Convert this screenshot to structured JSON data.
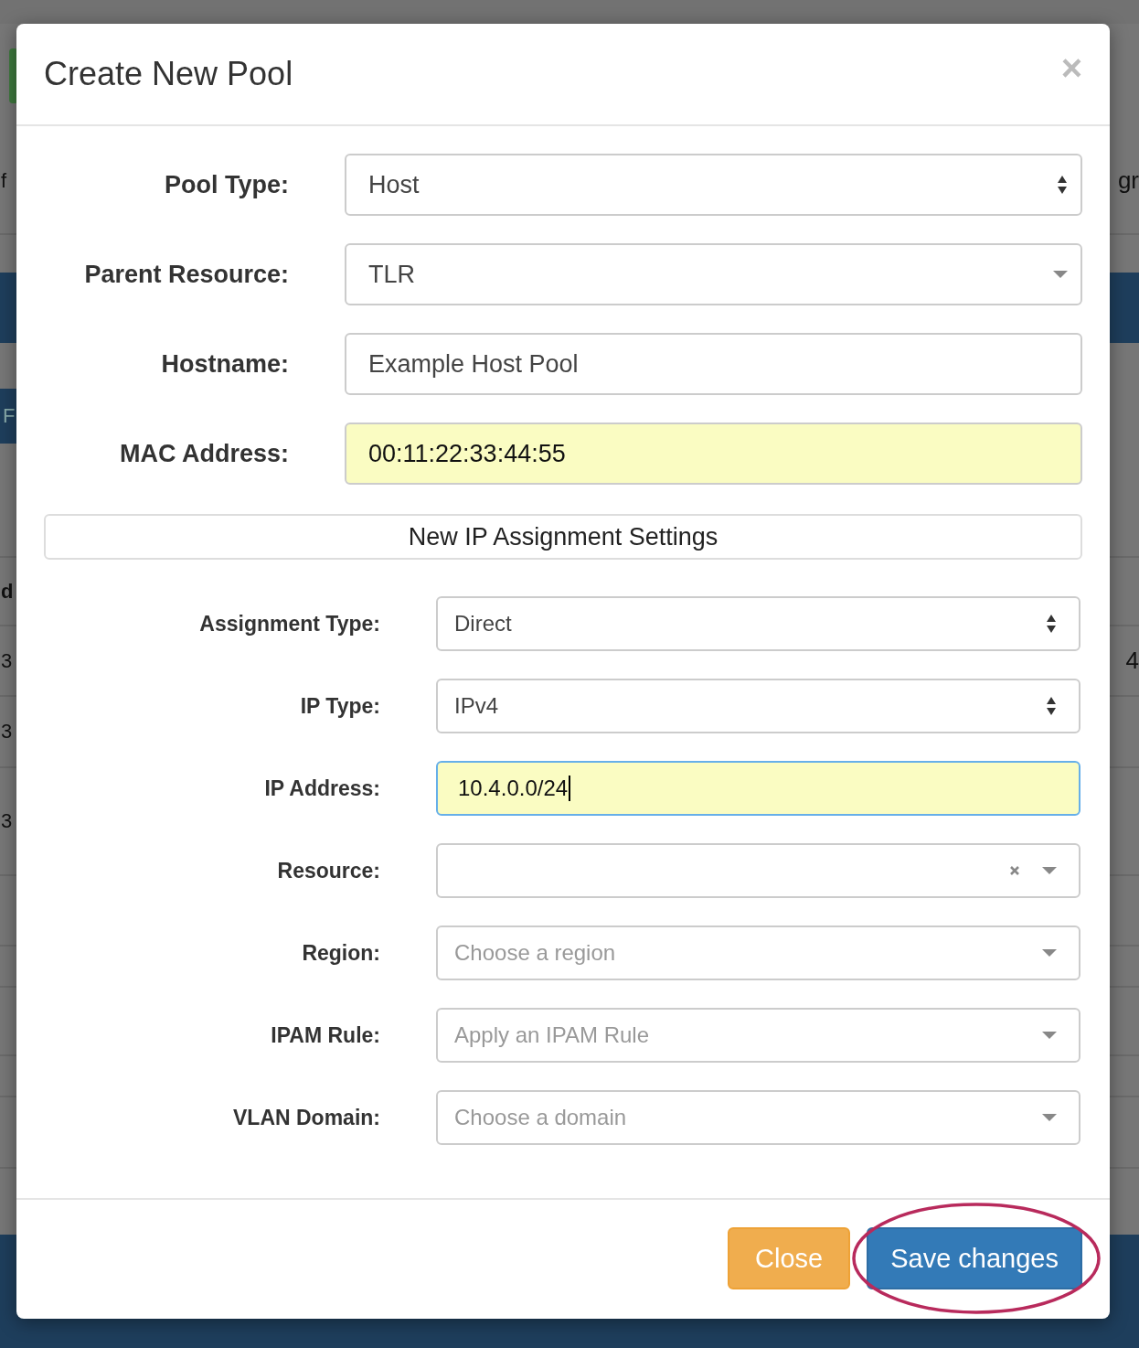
{
  "background": {
    "left_fragments": [
      "f",
      "F",
      "d",
      "3",
      "3",
      "3"
    ],
    "right_fragments": [
      "gr",
      "4"
    ]
  },
  "dialog": {
    "title": "Create New Pool",
    "close_symbol": "×",
    "fields": [
      {
        "label": "Pool Type:",
        "kind": "select",
        "value": "Host"
      },
      {
        "label": "Parent Resource:",
        "kind": "dropdown",
        "value": "TLR"
      },
      {
        "label": "Hostname:",
        "kind": "text",
        "value": "Example Host Pool"
      },
      {
        "label": "MAC Address:",
        "kind": "text",
        "value": "00:11:22:33:44:55",
        "autofilled": true
      }
    ],
    "section_title": "New IP Assignment Settings",
    "assignment_fields": [
      {
        "label": "Assignment Type:",
        "kind": "select",
        "value": "Direct"
      },
      {
        "label": "IP Type:",
        "kind": "select",
        "value": "IPv4"
      },
      {
        "label": "IP Address:",
        "kind": "text",
        "value": "10.4.0.0/24",
        "autofilled": true,
        "focused": true
      },
      {
        "label": "Resource:",
        "kind": "dropdown",
        "clearable": true
      },
      {
        "label": "Region:",
        "kind": "dropdown",
        "placeholder": "Choose a region"
      },
      {
        "label": "IPAM Rule:",
        "kind": "dropdown",
        "placeholder": "Apply an IPAM Rule"
      },
      {
        "label": "VLAN Domain:",
        "kind": "dropdown",
        "placeholder": "Choose a domain"
      }
    ],
    "buttons": [
      {
        "label": "Close",
        "kind": "warning"
      },
      {
        "label": "Save changes",
        "kind": "primary",
        "circled": true
      }
    ]
  }
}
